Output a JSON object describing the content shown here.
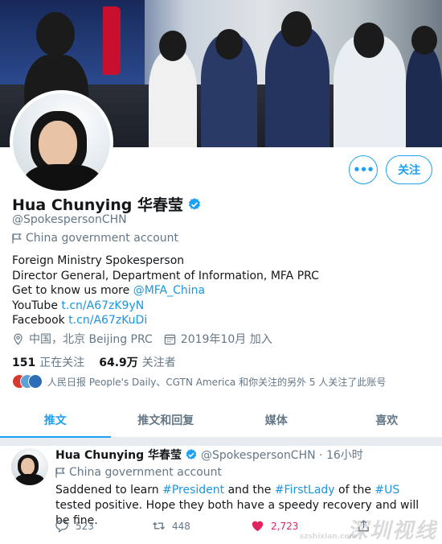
{
  "profile": {
    "name": "Hua Chunying 华春莹",
    "handle": "@SpokespersonCHN",
    "gov_label": "China government account",
    "bio_line1": "Foreign Ministry Spokesperson",
    "bio_line2": "Director General, Department of Information, MFA PRC",
    "bio_line3_text": "Get to know us more ",
    "bio_line3_link": "@MFA_China",
    "bio_line4_text": "YouTube ",
    "bio_line4_link": "t.cn/A67zK9yN",
    "bio_line5_text": "Facebook ",
    "bio_line5_link": "t.cn/A67zKuDi",
    "location": "中国，北京 Beijing PRC",
    "joined": "2019年10月 加入",
    "following_count": "151",
    "following_label": "正在关注",
    "followers_count": "64.9万",
    "followers_label": "关注者",
    "known_followers": "人民日报 People's Daily、CGTN America 和你关注的另外 5 人关注了此账号",
    "follow_button": "关注",
    "more_button": "•••"
  },
  "tabs": [
    "推文",
    "推文和回复",
    "媒体",
    "喜欢"
  ],
  "tweet": {
    "name": "Hua Chunying 华春莹",
    "handle_time": "@SpokespersonCHN · 16小时",
    "gov_label": "China government account",
    "text_1": "Saddened to learn ",
    "tag_1": "#President",
    "text_2": " and the ",
    "tag_2": "#FirstLady",
    "text_3": " of the ",
    "tag_3": "#US",
    "text_4": " tested positive. Hope they both have a speedy recovery and will be fine.",
    "replies": "523",
    "retweets": "448",
    "likes": "2,723"
  },
  "watermark": {
    "text": "深圳视线",
    "sub": "szshixian.com"
  },
  "colors": {
    "accent": "#1da1f2",
    "link": "#1b95e0",
    "like": "#e0245e",
    "muted": "#657786"
  }
}
